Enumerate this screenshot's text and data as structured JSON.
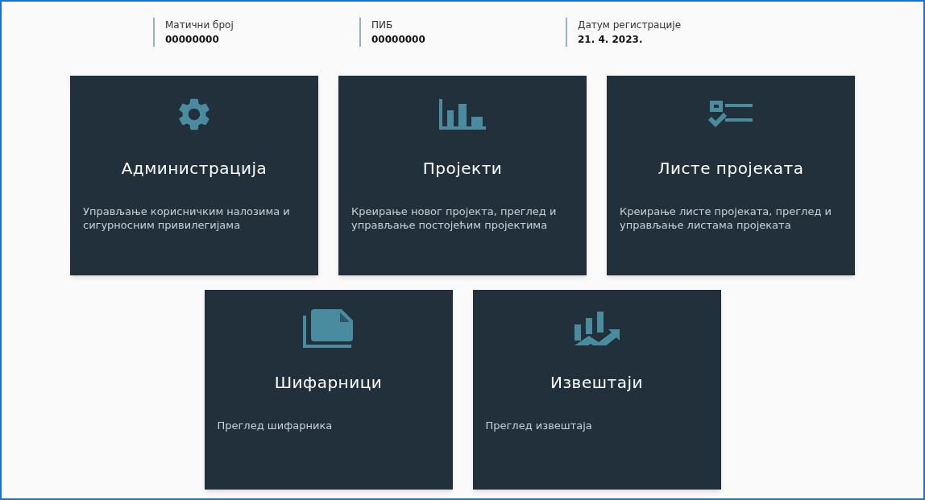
{
  "info": [
    {
      "label": "Матични број",
      "value": "00000000"
    },
    {
      "label": "ПИБ",
      "value": "00000000"
    },
    {
      "label": "Датум регистрације",
      "value": "21. 4. 2023."
    }
  ],
  "cards": [
    {
      "title": "Администрација",
      "description": "Управљање корисничким налозима и сигурносним привилегијама"
    },
    {
      "title": "Пројекти",
      "description": "Креирање новог пројекта, преглед и управљање постојећим пројектима"
    },
    {
      "title": "Листе пројеката",
      "description": "Креирање листе пројеката, преглед и управљање листама пројеката"
    },
    {
      "title": "Шифарници",
      "description": "Преглед шифарника"
    },
    {
      "title": "Извештаји",
      "description": "Преглед извештаја"
    }
  ]
}
